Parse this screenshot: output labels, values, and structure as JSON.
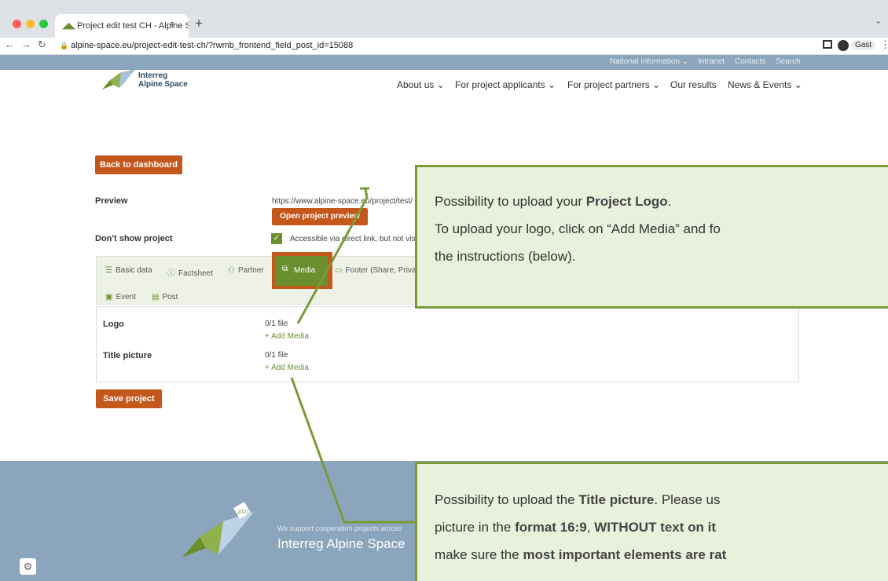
{
  "browser": {
    "tab_title": "Project edit test CH - Alpine Sp",
    "tab_close": "×",
    "new_tab": "+",
    "url": "alpine-space.eu/project-edit-test-ch/?rwmb_frontend_field_post_id=15088",
    "profile_label": "Gast"
  },
  "site": {
    "logo_line1": "Interreg",
    "logo_line2": "Alpine Space",
    "utility_nav": [
      "National information ⌄",
      "Intranet",
      "Contacts",
      "Search"
    ],
    "main_nav": [
      "About us ⌄",
      "For project applicants ⌄",
      "For project partners ⌄",
      "Our results",
      "News & Events ⌄"
    ]
  },
  "page": {
    "back_button": "Back to dashboard",
    "preview_label": "Preview",
    "preview_url": "https://www.alpine-space.eu/project/test/",
    "open_preview_button": "Open project preview",
    "dont_show_label": "Don't show project",
    "accessible_text": "Accessible via direct link, but not visib",
    "tabs": [
      "Basic data",
      "Factsheet",
      "Partner",
      "Media",
      "Footer (Share, Privac",
      "Event",
      "Post"
    ],
    "logo_label": "Logo",
    "logo_count": "0/1 file",
    "logo_add": "+ Add Media",
    "title_picture_label": "Title picture",
    "title_picture_count": "0/1 file",
    "title_picture_add": "+ Add Media",
    "save_button": "Save project"
  },
  "callout1": {
    "l1a": "Possibility to upload your ",
    "l1b": "Project Logo",
    "l1c": ".",
    "l2": "To upload your logo, click on “Add Media” and fo",
    "l3": "the instructions (below)."
  },
  "callout2": {
    "l1a": "Possibility to upload the ",
    "l1b": "Title picture",
    "l1c": ". Please us",
    "l2a": "picture in the ",
    "l2b": "format 16:9",
    "l2c": ", ",
    "l2d": "WITHOUT text on it",
    "l3a": "make sure the ",
    "l3b": "most important elements are rat"
  },
  "footer": {
    "tagline": "We support cooperation projects across",
    "brand": "Interreg Alpine Space",
    "badge": "2021"
  },
  "colors": {
    "accent": "#c4571c",
    "callout_border": "#7a9a3a",
    "header_blue": "#8ba5bd"
  }
}
